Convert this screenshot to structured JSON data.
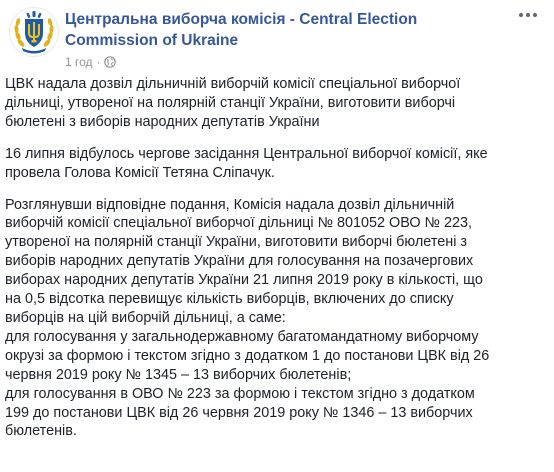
{
  "post": {
    "author": {
      "name_line1": "Центральна виборча комісія - Central Election",
      "name_line2": "Commission of Ukraine",
      "avatar_icon": "cec-emblem-icon"
    },
    "timestamp": "1 год",
    "privacy_icon": "globe-icon",
    "menu_icon": "more-options-icon",
    "paragraphs": [
      [
        "ЦВК надала дозвіл дільничній виборчій комісії спеціальної виборчої",
        "дільниці, утвореної на полярній станції України, виготовити виборчі",
        "бюлетені з виборів народних депутатів України"
      ],
      [
        "16 липня відбулось чергове засідання Центральної виборчої комісії, яке",
        "провела Голова Комісії Тетяна Сліпачук."
      ],
      [
        "Розглянувши відповідне подання, Комісія надала дозвіл дільничній",
        "виборчій комісії спеціальної виборчої дільниці № 801052 ОВО № 223,",
        "утвореної на полярній станції України, виготовити виборчі бюлетені з",
        "виборів народних депутатів України для голосування на позачергових",
        "виборах народних депутатів України 21 липня 2019 року в кількості, що",
        "на 0,5 відсотка перевищує кількість виборців, включених до списку",
        "виборців на цій виборчій дільниці, а саме:",
        "для голосування у загальнодержавному багатомандатному виборчому",
        "окрузі за формою і текстом згідно з додатком 1 до постанови ЦВК від 26",
        "червня 2019 року № 1345 – 13 виборчих бюлетенів;",
        "для голосування в ОВО № 223 за формою і текстом згідно з додатком",
        "199 до постанови ЦВК від 26 червня 2019 року № 1346 – 13 виборчих",
        "бюлетенів."
      ]
    ]
  },
  "colors": {
    "link": "#365899",
    "meta": "#90949c",
    "text": "#1d2129",
    "emblem_blue": "#1e5aa8",
    "emblem_yellow": "#f4c20d"
  }
}
